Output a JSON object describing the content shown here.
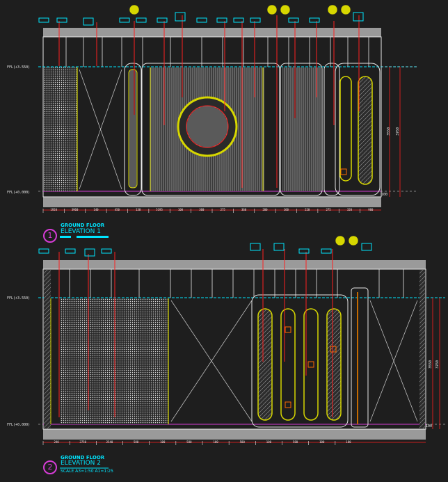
{
  "elevation1": {
    "number": "1",
    "title_line1": "GROUND FLOOR",
    "title_line2": "ELEVATION 1",
    "dims": [
      "1920",
      "3960",
      "140",
      "450",
      "130",
      "5195",
      "100",
      "360",
      "275",
      "360",
      "200",
      "160",
      "220",
      "275",
      "320",
      "980"
    ],
    "vdims": [
      "3550",
      "3760",
      "100"
    ],
    "level_top": "FFL(+3.550)",
    "level_bottom": "FFL(+0.000)"
  },
  "elevation2": {
    "number": "2",
    "title_line1": "GROUND FLOOR",
    "title_line2": "ELEVATION 2",
    "scale": "SCALE A3=1:50 A1=1:25",
    "dims": [
      "240",
      "3750",
      "2540",
      "580",
      "100",
      "580",
      "100",
      "580",
      "100",
      "580",
      "100",
      "180"
    ],
    "vdims": [
      "3550",
      "3760",
      "100"
    ],
    "level_top": "FFL(+3.550)",
    "level_bottom": "FFL(+0.000)"
  },
  "colors": {
    "background": "#1e1e1e",
    "frame_fill": "#9a9a9a",
    "cyan": "#00e5ff",
    "red": "#ff2020",
    "yellow": "#d7d700",
    "white": "#e8e8e8",
    "magenta": "#d63cd6",
    "olive": "#a8a838"
  }
}
